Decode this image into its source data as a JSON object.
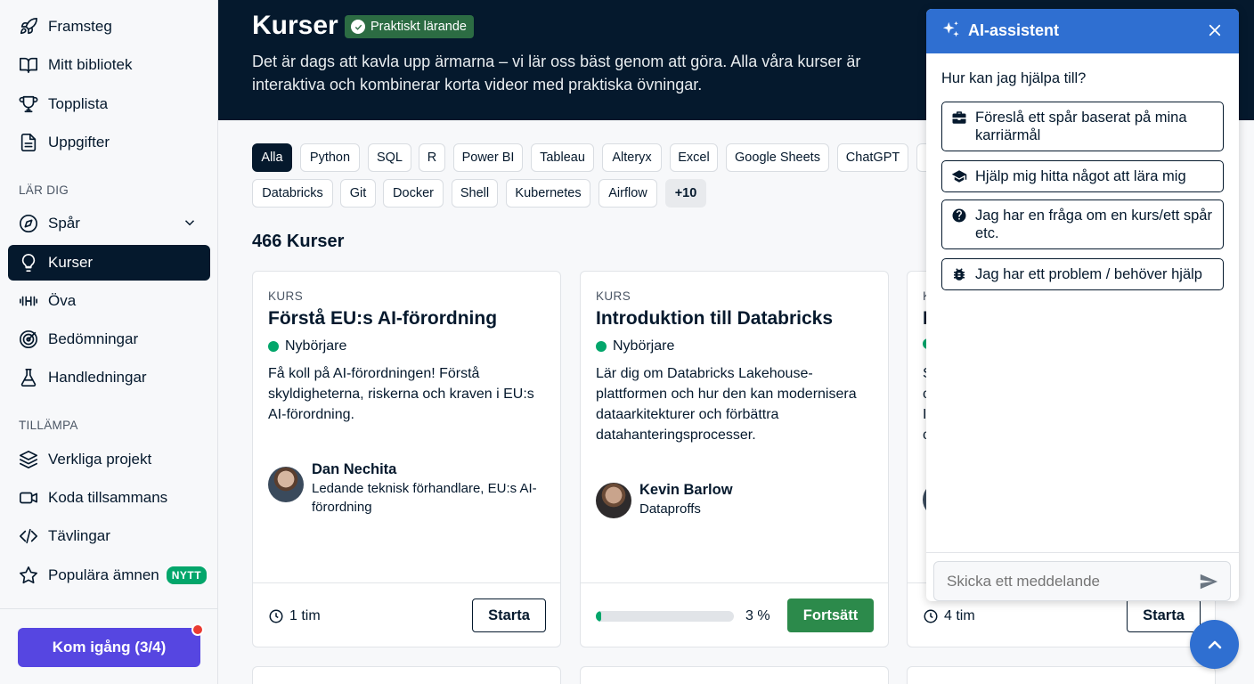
{
  "sidebar": {
    "items": [
      {
        "label": "Framsteg",
        "icon": "rocket-icon"
      },
      {
        "label": "Mitt bibliotek",
        "icon": "book-icon"
      },
      {
        "label": "Topplista",
        "icon": "trophy-icon"
      },
      {
        "label": "Uppgifter",
        "icon": "document-icon"
      }
    ],
    "section_learn": "LÄR DIG",
    "learn_items": [
      {
        "label": "Spår",
        "icon": "compass-icon"
      },
      {
        "label": "Kurser",
        "icon": "lightbulb-icon"
      },
      {
        "label": "Öva",
        "icon": "dumbbell-icon"
      },
      {
        "label": "Bedömningar",
        "icon": "target-icon"
      },
      {
        "label": "Handledningar",
        "icon": "flask-icon"
      }
    ],
    "section_apply": "TILLÄMPA",
    "apply_items": [
      {
        "label": "Verkliga projekt",
        "icon": "layers-icon"
      },
      {
        "label": "Koda tillsammans",
        "icon": "video-icon"
      },
      {
        "label": "Tävlingar",
        "icon": "code-icon"
      },
      {
        "label": "Populära ämnen",
        "icon": "star-icon"
      }
    ],
    "new_badge": "NYTT",
    "start_button": "Kom igång (3/4)"
  },
  "hero": {
    "title": "Kurser",
    "badge": "Praktiskt lärande",
    "description": "Det är dags att kavla upp ärmarna – vi lär oss bäst genom att göra. Alla våra kurser är interaktiva och kombinerar korta videor med praktiska övningar."
  },
  "filters": [
    "Alla",
    "Python",
    "SQL",
    "R",
    "Power BI",
    "Tableau",
    "Alteryx",
    "Excel",
    "Google Sheets",
    "ChatGPT",
    "Databricks",
    "Git",
    "Docker",
    "Shell",
    "Kubernetes",
    "Airflow",
    "+10"
  ],
  "course_count": "466 Kurser",
  "cards": [
    {
      "type": "KURS",
      "title": "Förstå EU:s AI-förordning",
      "level": "Nybörjare",
      "description": "Få koll på AI-förordningen! Förstå skyldigheterna, riskerna och kraven i EU:s AI-förordning.",
      "author_name": "Dan Nechita",
      "author_role": "Ledande teknisk förhandlare, EU:s AI-förordning",
      "duration": "1 tim",
      "action": "Starta"
    },
    {
      "type": "KURS",
      "title": "Introduktion till Databricks",
      "level": "Nybörjare",
      "description": "Lär dig om Databricks Lakehouse-plattformen och hur den kan modernisera dataarkitekturer och förbättra datahanteringsprocesser.",
      "author_name": "Kevin Barlow",
      "author_role": "Dataproffs",
      "progress": 0.03,
      "progress_label": "3 %",
      "action": "Fortsätt"
    },
    {
      "type": "K",
      "title": "I",
      "description_lines": [
        "S",
        "c",
        "I",
        "c"
      ],
      "duration": "4 tim",
      "action": "Starta"
    }
  ],
  "ai": {
    "title": "AI-assistent",
    "question": "Hur kan jag hjälpa till?",
    "options": [
      {
        "label": "Föreslå ett spår baserat på mina karriärmål",
        "icon": "briefcase-icon"
      },
      {
        "label": "Hjälp mig hitta något att lära mig",
        "icon": "graduation-cap-icon"
      },
      {
        "label": "Jag har en fråga om en kurs/ett spår etc.",
        "icon": "question-icon"
      },
      {
        "label": "Jag har ett problem / behöver hjälp",
        "icon": "bug-icon"
      }
    ],
    "input_placeholder": "Skicka ett meddelande"
  },
  "colors": {
    "navy": "#05192d",
    "accent_blue": "#2f6fd1",
    "green": "#03a66b",
    "purple": "#5646e1"
  }
}
